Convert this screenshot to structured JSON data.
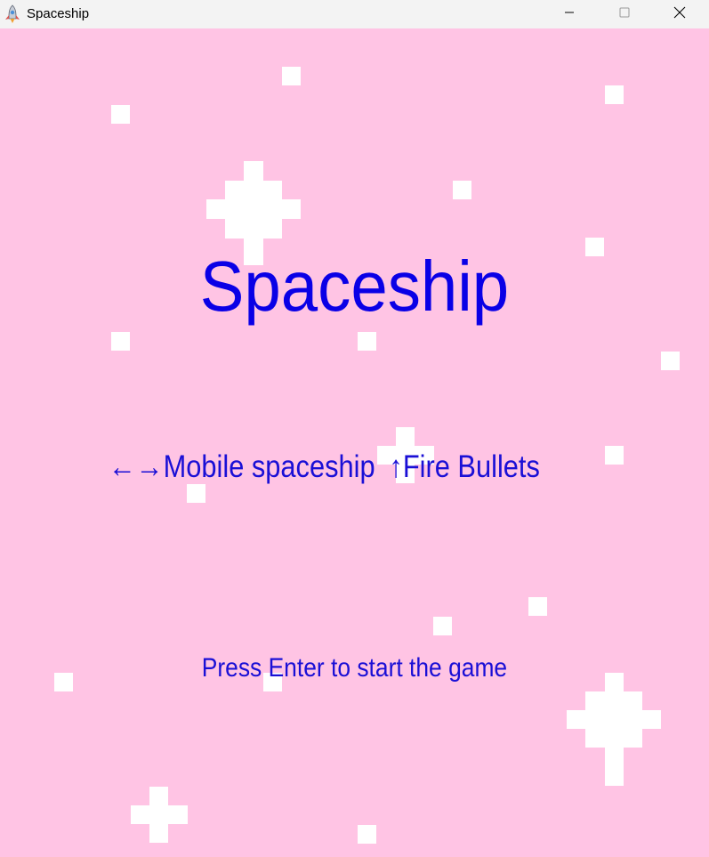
{
  "window": {
    "title": "Spaceship",
    "icon": "rocket-app-icon",
    "controls": [
      "minimize-icon",
      "maximize-icon",
      "close-icon"
    ]
  },
  "game": {
    "title": "Spaceship",
    "controls": {
      "move_arrows": "←→",
      "move_label": "Mobile spaceship",
      "fire_arrow": "↑",
      "fire_label": "Fire Bullets"
    },
    "start_prompt": "Press Enter to start the game"
  },
  "colors": {
    "background": "#ffc4e4",
    "stars": "#ffffff",
    "text": "#1a0fd6",
    "title_text": "#0a00e6",
    "titlebar": "#f3f3f3"
  }
}
